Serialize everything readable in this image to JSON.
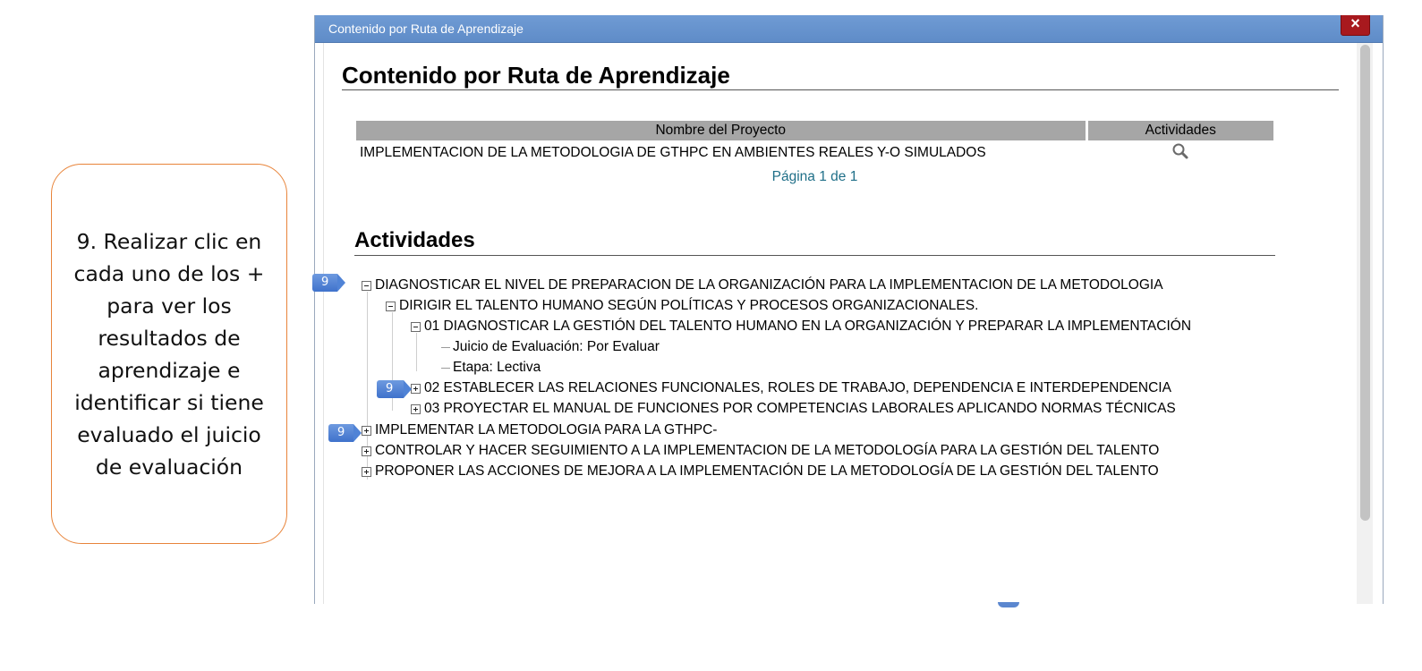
{
  "callout": {
    "text": "9.  Realizar clic en cada uno de los + para ver los resultados de aprendizaje  e identificar si tiene evaluado el juicio de evaluación"
  },
  "window": {
    "title": "Contenido por Ruta de Aprendizaje",
    "close_label": "×"
  },
  "page": {
    "heading": "Contenido por Ruta de Aprendizaje"
  },
  "project_table": {
    "headers": [
      "Nombre del Proyecto",
      "Actividades"
    ],
    "rows": [
      {
        "name": "IMPLEMENTACION DE LA METODOLOGIA DE GTHPC EN AMBIENTES REALES Y-O SIMULADOS",
        "action_icon": "search-icon"
      }
    ],
    "pager": "Página 1 de 1"
  },
  "activities": {
    "heading": "Actividades",
    "items": [
      "DIAGNOSTICAR EL NIVEL DE PREPARACION DE LA ORGANIZACIÓN PARA LA IMPLEMENTACION DE LA METODOLOGIA",
      "DIRIGIR EL TALENTO HUMANO SEGÚN POLÍTICAS Y PROCESOS ORGANIZACIONALES.",
      "01 DIAGNOSTICAR LA GESTIÓN DEL TALENTO HUMANO EN LA ORGANIZACIÓN Y PREPARAR LA IMPLEMENTACIÓN",
      "Juicio de Evaluación: Por Evaluar",
      "Etapa: Lectiva",
      "02 ESTABLECER LAS RELACIONES FUNCIONALES, ROLES DE TRABAJO, DEPENDENCIA E INTERDEPENDENCIA",
      "03 PROYECTAR EL MANUAL DE FUNCIONES POR COMPETENCIAS LABORALES APLICANDO NORMAS TÉCNICAS",
      "IMPLEMENTAR LA METODOLOGIA PARA LA GTHPC-",
      "CONTROLAR Y HACER SEGUIMIENTO A LA IMPLEMENTACION DE LA METODOLOGÍA PARA LA GESTIÓN DEL TALENTO",
      "PROPONER LAS ACCIONES DE MEJORA A LA IMPLEMENTACIÓN DE LA METODOLOGÍA DE LA GESTIÓN DEL TALENTO"
    ]
  },
  "badges": {
    "step": "9"
  },
  "colors": {
    "titlebar": "#6f9bd4",
    "close": "#a8191e",
    "callout_border": "#e8843a",
    "badge": "#4a7fd4",
    "pager": "#1f6f88"
  }
}
